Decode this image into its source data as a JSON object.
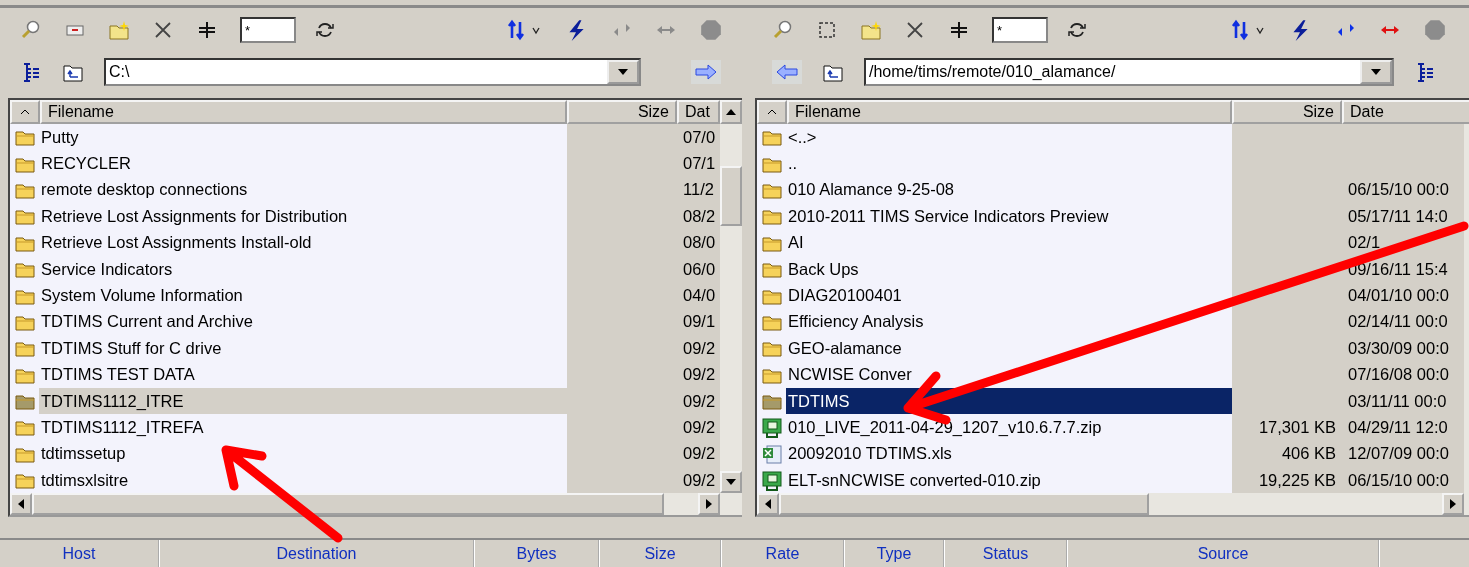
{
  "panes": [
    {
      "kind": "local",
      "active": false,
      "filter": "*",
      "path": "C:\\",
      "transfer_buttons_enabled": false,
      "columns": [
        "Filename",
        "Size",
        "Dat"
      ],
      "rows": [
        {
          "kind": "folder",
          "name": "Putty",
          "size": "",
          "date": "07/0",
          "selected": false
        },
        {
          "kind": "folder",
          "name": "RECYCLER",
          "size": "",
          "date": "07/1",
          "selected": false
        },
        {
          "kind": "folder",
          "name": "remote desktop connections",
          "size": "",
          "date": "11/2",
          "selected": false
        },
        {
          "kind": "folder",
          "name": "Retrieve Lost Assignments for Distribution",
          "size": "",
          "date": "08/2",
          "selected": false
        },
        {
          "kind": "folder",
          "name": "Retrieve Lost Assignments Install-old",
          "size": "",
          "date": "08/0",
          "selected": false
        },
        {
          "kind": "folder",
          "name": "Service Indicators",
          "size": "",
          "date": "06/0",
          "selected": false
        },
        {
          "kind": "folder",
          "name": "System Volume Information",
          "size": "",
          "date": "04/0",
          "selected": false
        },
        {
          "kind": "folder",
          "name": "TDTIMS Current and Archive",
          "size": "",
          "date": "09/1",
          "selected": false
        },
        {
          "kind": "folder",
          "name": "TDTIMS Stuff for C drive",
          "size": "",
          "date": "09/2",
          "selected": false
        },
        {
          "kind": "folder",
          "name": "TDTIMS TEST DATA",
          "size": "",
          "date": "09/2",
          "selected": false
        },
        {
          "kind": "folder",
          "name": "TDTIMS1112_ITRE",
          "size": "",
          "date": "09/2",
          "selected": true
        },
        {
          "kind": "folder",
          "name": "TDTIMS1112_ITREFA",
          "size": "",
          "date": "09/2",
          "selected": false
        },
        {
          "kind": "folder",
          "name": "tdtimssetup",
          "size": "",
          "date": "09/2",
          "selected": false
        },
        {
          "kind": "folder",
          "name": "tdtimsxlsitre",
          "size": "",
          "date": "09/2",
          "selected": false
        }
      ]
    },
    {
      "kind": "remote",
      "active": true,
      "filter": "*",
      "path": "/home/tims/remote/010_alamance/",
      "transfer_buttons_enabled": true,
      "columns": [
        "Filename",
        "Size",
        "Date"
      ],
      "rows": [
        {
          "kind": "folder",
          "name": "<..>",
          "size": "",
          "date": "",
          "selected": false
        },
        {
          "kind": "folder",
          "name": "..",
          "size": "",
          "date": "",
          "selected": false
        },
        {
          "kind": "folder",
          "name": "010 Alamance 9-25-08",
          "size": "",
          "date": "06/15/10 00:0",
          "selected": false
        },
        {
          "kind": "folder",
          "name": "2010-2011 TIMS Service Indicators Preview",
          "size": "",
          "date": "05/17/11 14:0",
          "selected": false
        },
        {
          "kind": "folder",
          "name": "AI",
          "size": "",
          "date": "02/1",
          "selected": false
        },
        {
          "kind": "folder",
          "name": "Back Ups",
          "size": "",
          "date": "09/16/11 15:4",
          "selected": false
        },
        {
          "kind": "folder",
          "name": "DIAG20100401",
          "size": "",
          "date": "04/01/10 00:0",
          "selected": false
        },
        {
          "kind": "folder",
          "name": "Efficiency Analysis",
          "size": "",
          "date": "02/14/11 00:0",
          "selected": false
        },
        {
          "kind": "folder",
          "name": "GEO-alamance",
          "size": "",
          "date": "03/30/09 00:0",
          "selected": false
        },
        {
          "kind": "folder",
          "name": "NCWISE Conver",
          "size": "",
          "date": "07/16/08 00:0",
          "selected": false
        },
        {
          "kind": "folder",
          "name": "TDTIMS",
          "size": "",
          "date": "03/11/11 00:0",
          "selected": true
        },
        {
          "kind": "zip",
          "name": "010_LIVE_2011-04-29_1207_v10.6.7.7.zip",
          "size": "17,301 KB",
          "date": "04/29/11 12:0",
          "selected": false
        },
        {
          "kind": "xls",
          "name": "20092010 TDTIMS.xls",
          "size": "406 KB",
          "date": "12/07/09 00:0",
          "selected": false
        },
        {
          "kind": "zip",
          "name": "ELT-snNCWISE converted-010.zip",
          "size": "19,225 KB",
          "date": "06/15/10 00:0",
          "selected": false
        }
      ]
    }
  ],
  "queue_columns": [
    "Host",
    "Destination",
    "Bytes",
    "Size",
    "Rate",
    "Type",
    "Status",
    "Source"
  ]
}
